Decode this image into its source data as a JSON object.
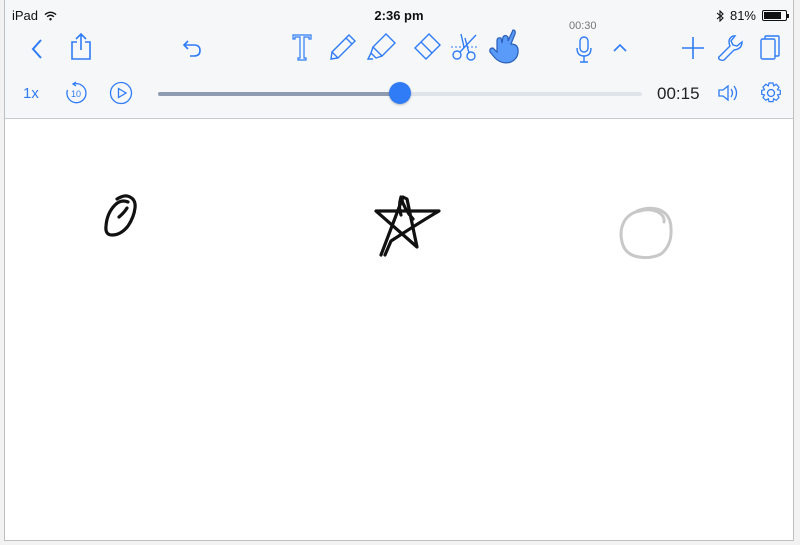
{
  "status": {
    "device": "iPad",
    "time": "2:36 pm",
    "battery_percent": "81%",
    "battery_level": 0.81
  },
  "toolbar": {
    "record_time": "00:30",
    "icons": [
      "back-icon",
      "share-icon",
      "undo-icon",
      "text-tool-icon",
      "pen-icon",
      "highlighter-icon",
      "eraser-icon",
      "scissors-icon",
      "hand-pointer-icon",
      "microphone-icon",
      "chevron-up-icon",
      "add-icon",
      "wrench-icon",
      "pages-icon"
    ],
    "accent_color": "#2f7cf6"
  },
  "playback": {
    "speed": "1x",
    "elapsed": "00:15",
    "progress": 0.5
  },
  "canvas": {
    "strokes": [
      {
        "name": "circled-stroke",
        "color": "#111111"
      },
      {
        "name": "star-stroke",
        "color": "#111111"
      },
      {
        "name": "faded-circle-stroke",
        "color": "#c8c8c8"
      }
    ]
  }
}
